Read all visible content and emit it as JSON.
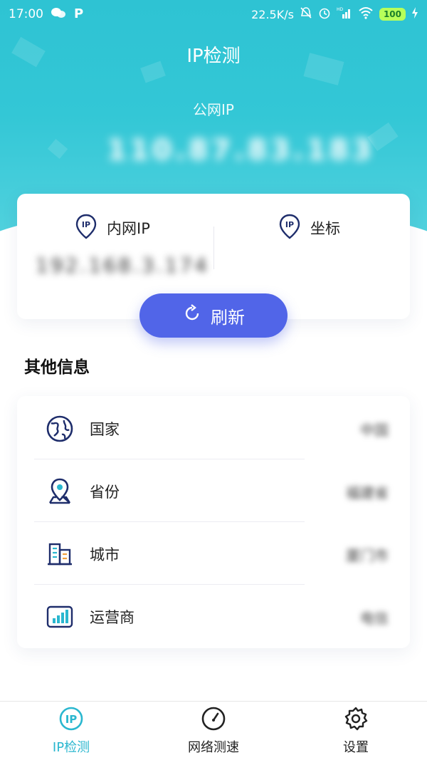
{
  "status_bar": {
    "time": "17:00",
    "net_speed": "22.5K/s",
    "network_badge": "HD",
    "battery": "100"
  },
  "header": {
    "title": "IP检测",
    "public_ip_label": "公网IP",
    "public_ip_value": "110.87.83.183"
  },
  "ip_card": {
    "inner_ip_label": "内网IP",
    "inner_ip_value": "192.168.3.174",
    "coord_label": "坐标",
    "ip_badge_text": "IP"
  },
  "refresh_button": {
    "label": "刷新"
  },
  "other_info": {
    "title": "其他信息",
    "rows": [
      {
        "icon": "globe-icon",
        "label": "国家",
        "value": "中国"
      },
      {
        "icon": "map-pin-icon",
        "label": "省份",
        "value": "福建省"
      },
      {
        "icon": "building-icon",
        "label": "城市",
        "value": "厦门市"
      },
      {
        "icon": "signal-bars-icon",
        "label": "运营商",
        "value": "电信"
      }
    ]
  },
  "tab_bar": {
    "tabs": [
      {
        "label": "IP检测",
        "icon": "ip-icon",
        "active": true
      },
      {
        "label": "网络测速",
        "icon": "speedometer-icon",
        "active": false
      },
      {
        "label": "设置",
        "icon": "gear-icon",
        "active": false
      }
    ]
  },
  "colors": {
    "accent": "#5165e8",
    "hero": "#2ec3d3",
    "active_tab": "#2ab7cf",
    "icon_navy": "#1e2d6b"
  }
}
